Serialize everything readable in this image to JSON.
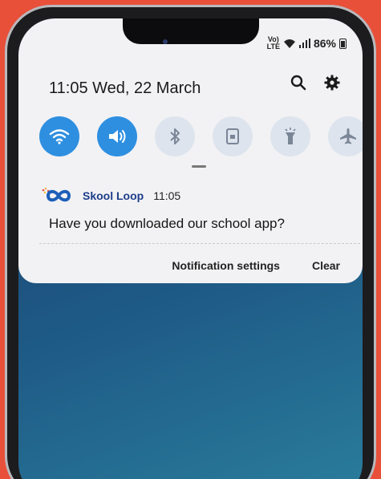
{
  "status_bar": {
    "network_top": "Vo)",
    "network_bottom": "LTE",
    "battery": "86%"
  },
  "header": {
    "datetime": "11:05  Wed, 22 March",
    "icons": [
      "search-icon",
      "gear-icon"
    ]
  },
  "quick_settings": [
    {
      "icon": "wifi-icon",
      "active": true
    },
    {
      "icon": "sound-icon",
      "active": true
    },
    {
      "icon": "bluetooth-icon",
      "active": false
    },
    {
      "icon": "rotation-lock-icon",
      "active": false
    },
    {
      "icon": "flashlight-icon",
      "active": false
    },
    {
      "icon": "airplane-icon",
      "active": false
    }
  ],
  "notification": {
    "app_name": "Skool Loop",
    "time": "11:05",
    "message": "Have you downloaded our school app?"
  },
  "actions": {
    "settings_label": "Notification settings",
    "clear_label": "Clear"
  },
  "colors": {
    "background": "#e8503a",
    "active_toggle": "#2e8fe0",
    "inactive_toggle": "#dde4ee",
    "app_name": "#1d3d8a"
  }
}
